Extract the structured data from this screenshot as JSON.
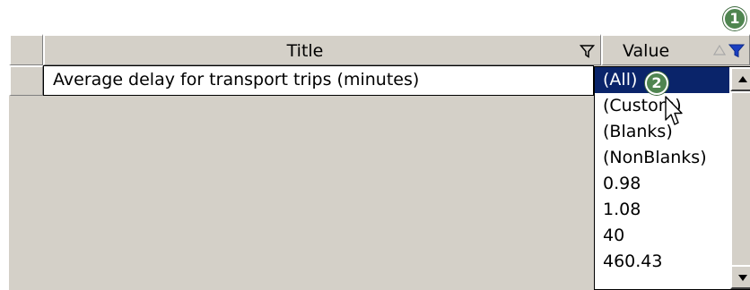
{
  "columns": {
    "title": {
      "label": "Title",
      "filter_icon": "funnel-outline-icon"
    },
    "value": {
      "label": "Value",
      "sort_icon": "sort-ascending-icon",
      "filter_icon": "funnel-active-icon"
    }
  },
  "rows": [
    {
      "title": "Average delay for transport trips (minutes)"
    }
  ],
  "dropdown": {
    "items": [
      "(All)",
      "(Custom)",
      "(Blanks)",
      "(NonBlanks)",
      "0.98",
      "1.08",
      "40",
      "460.43"
    ],
    "selected_index": 0
  },
  "callouts": [
    "1",
    "2"
  ],
  "colors": {
    "selection": "#0a246a",
    "badge": "#4f8550",
    "active_filter_icon": "#1a3fc1",
    "chrome": "#d4d0c8"
  }
}
